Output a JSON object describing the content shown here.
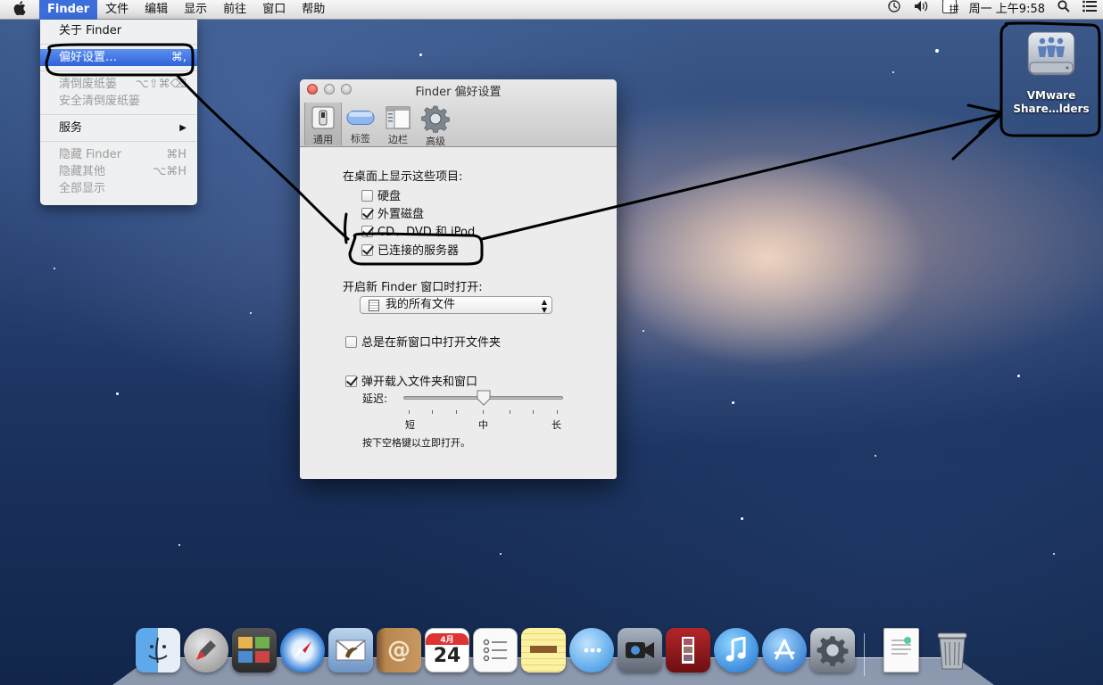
{
  "menubar": {
    "apple_icon": "",
    "app_name": "Finder",
    "menus": [
      "文件",
      "编辑",
      "显示",
      "前往",
      "窗口",
      "帮助"
    ],
    "status": {
      "time_machine_icon": "time-machine-icon",
      "volume_icon": "volume-icon",
      "input_method": "拼",
      "clock": "周一 上午9:58",
      "spotlight_icon": "spotlight-icon",
      "notification_icon": "notification-center-icon"
    }
  },
  "finder_menu": {
    "about": "关于 Finder",
    "preferences": "偏好设置…",
    "preferences_shortcut": "⌘,",
    "empty_trash": "清倒废纸篓",
    "empty_trash_shortcut": "⌥⇧⌘⌫",
    "secure_empty_trash": "安全清倒废纸篓",
    "services": "服务",
    "services_arrow": "▶",
    "hide_finder": "隐藏 Finder",
    "hide_finder_shortcut": "⌘H",
    "hide_others": "隐藏其他",
    "hide_others_shortcut": "⌥⌘H",
    "show_all": "全部显示"
  },
  "prefs_window": {
    "title": "Finder 偏好设置",
    "tabs": [
      {
        "label": "通用",
        "active": true
      },
      {
        "label": "标签",
        "active": false
      },
      {
        "label": "边栏",
        "active": false
      },
      {
        "label": "高级",
        "active": false
      }
    ],
    "desktop_section_label": "在桌面上显示这些项目:",
    "desktop_items": [
      {
        "label": "硬盘",
        "checked": false
      },
      {
        "label": "外置磁盘",
        "checked": true
      },
      {
        "label": "CD、DVD 和 iPod",
        "checked": true
      },
      {
        "label": "已连接的服务器",
        "checked": true
      }
    ],
    "new_window_label": "开启新 Finder 窗口时打开:",
    "new_window_value": "我的所有文件",
    "always_new_window": {
      "label": "总是在新窗口中打开文件夹",
      "checked": false
    },
    "spring_loaded": {
      "label": "弹开载入文件夹和窗口",
      "checked": true
    },
    "delay_label": "延迟:",
    "delay_min": "短",
    "delay_mid": "中",
    "delay_max": "长",
    "delay_level": 0.5,
    "space_hint": "按下空格键以立即打开。"
  },
  "desktop_icon": {
    "line1": "VMware",
    "line2": "Share…lders"
  },
  "dock": {
    "items": [
      "finder",
      "launchpad",
      "photo-browser",
      "safari",
      "mail",
      "contacts",
      "calendar",
      "reminders",
      "notes",
      "messages",
      "facetime",
      "photo-booth",
      "itunes",
      "app-store",
      "system-preferences",
      "document",
      "trash"
    ],
    "calendar_day": "24",
    "calendar_month": "4月"
  },
  "colors": {
    "menu_highlight": "#3d6fdc",
    "annotation": "#000000"
  }
}
